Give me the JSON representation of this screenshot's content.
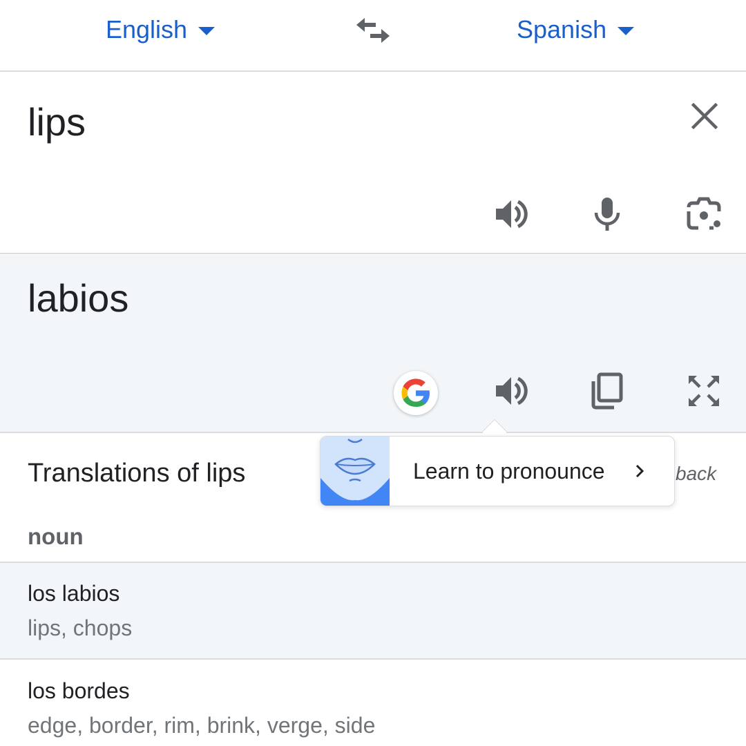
{
  "language_bar": {
    "source_language": "English",
    "target_language": "Spanish",
    "accent_color": "#1a5fcc"
  },
  "source": {
    "text": "lips",
    "icons": [
      "clear-icon",
      "speaker-icon",
      "microphone-icon",
      "camera-icon"
    ]
  },
  "target": {
    "text": "labios",
    "icons": [
      "google-logo-icon",
      "speaker-icon",
      "copy-icon",
      "fullscreen-icon"
    ],
    "background": "#f3f6f8"
  },
  "tooltip": {
    "label": "Learn to pronounce"
  },
  "translations": {
    "title": "Translations of lips",
    "feedback_label": "back",
    "part_of_speech": "noun",
    "entries": [
      {
        "word": "los labios",
        "synonyms": "lips, chops"
      },
      {
        "word": "los bordes",
        "synonyms": "edge, border, rim, brink, verge, side"
      }
    ]
  }
}
